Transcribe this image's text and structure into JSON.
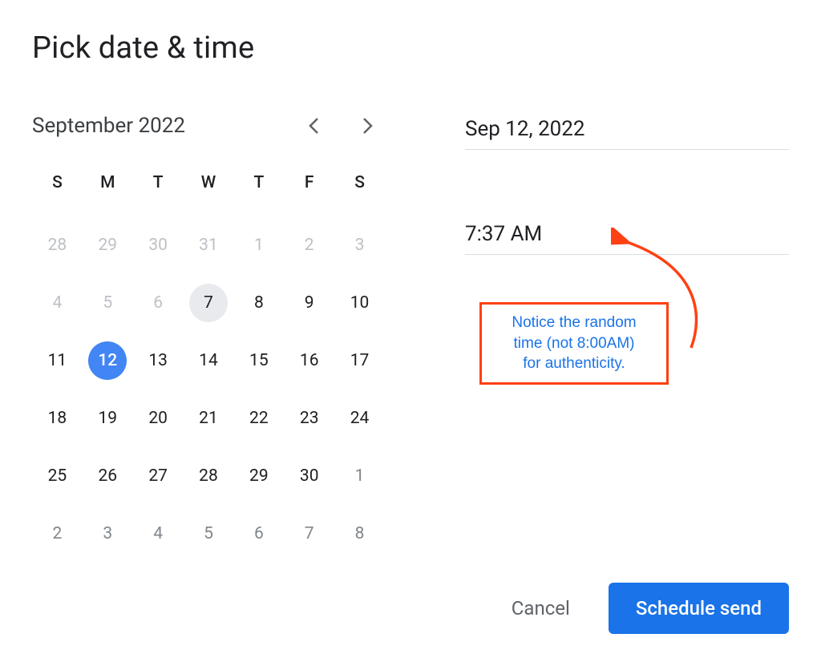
{
  "title": "Pick date & time",
  "calendar": {
    "month_label": "September 2022",
    "dow": [
      "S",
      "M",
      "T",
      "W",
      "T",
      "F",
      "S"
    ],
    "weeks": [
      [
        {
          "n": "28",
          "cls": "muted"
        },
        {
          "n": "29",
          "cls": "muted"
        },
        {
          "n": "30",
          "cls": "muted"
        },
        {
          "n": "31",
          "cls": "muted"
        },
        {
          "n": "1",
          "cls": "muted"
        },
        {
          "n": "2",
          "cls": "muted"
        },
        {
          "n": "3",
          "cls": "muted"
        }
      ],
      [
        {
          "n": "4",
          "cls": "muted"
        },
        {
          "n": "5",
          "cls": "muted"
        },
        {
          "n": "6",
          "cls": "muted"
        },
        {
          "n": "7",
          "cls": "today"
        },
        {
          "n": "8",
          "cls": ""
        },
        {
          "n": "9",
          "cls": ""
        },
        {
          "n": "10",
          "cls": ""
        }
      ],
      [
        {
          "n": "11",
          "cls": ""
        },
        {
          "n": "12",
          "cls": "selected"
        },
        {
          "n": "13",
          "cls": ""
        },
        {
          "n": "14",
          "cls": ""
        },
        {
          "n": "15",
          "cls": ""
        },
        {
          "n": "16",
          "cls": ""
        },
        {
          "n": "17",
          "cls": ""
        }
      ],
      [
        {
          "n": "18",
          "cls": ""
        },
        {
          "n": "19",
          "cls": ""
        },
        {
          "n": "20",
          "cls": ""
        },
        {
          "n": "21",
          "cls": ""
        },
        {
          "n": "22",
          "cls": ""
        },
        {
          "n": "23",
          "cls": ""
        },
        {
          "n": "24",
          "cls": ""
        }
      ],
      [
        {
          "n": "25",
          "cls": ""
        },
        {
          "n": "26",
          "cls": ""
        },
        {
          "n": "27",
          "cls": ""
        },
        {
          "n": "28",
          "cls": ""
        },
        {
          "n": "29",
          "cls": ""
        },
        {
          "n": "30",
          "cls": ""
        },
        {
          "n": "1",
          "cls": "muted2"
        }
      ],
      [
        {
          "n": "2",
          "cls": "muted2"
        },
        {
          "n": "3",
          "cls": "muted2"
        },
        {
          "n": "4",
          "cls": "muted2"
        },
        {
          "n": "5",
          "cls": "muted2"
        },
        {
          "n": "6",
          "cls": "muted2"
        },
        {
          "n": "7",
          "cls": "muted2"
        },
        {
          "n": "8",
          "cls": "muted2"
        }
      ]
    ]
  },
  "inputs": {
    "date_value": "Sep 12, 2022",
    "time_value": "7:37 AM"
  },
  "annotation": {
    "line1": "Notice the random",
    "line2": "time (not 8:00AM)",
    "line3": "for authenticity."
  },
  "footer": {
    "cancel": "Cancel",
    "schedule": "Schedule send"
  }
}
